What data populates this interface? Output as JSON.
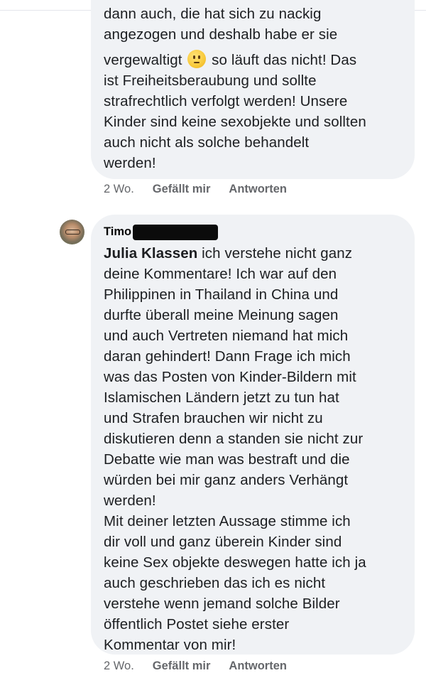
{
  "comment_1": {
    "lines": [
      "dann auch, die hat sich zu nackig",
      "angezogen und deshalb habe er sie",
      "vergewaltigt",
      " so läuft das nicht! Das",
      "ist Freiheitsberaubung und sollte",
      "strafrechtlich verfolgt werden! Unsere",
      "Kinder sind keine sexobjekte und sollten",
      "auch nicht als solche behandelt",
      "werden!"
    ],
    "emoji": "slightly-smiling-face-icon",
    "time": "2 Wo.",
    "like_label": "Gefällt mir",
    "reply_label": "Antworten"
  },
  "comment_2": {
    "author": "Timo",
    "mention": "Julia Klassen",
    "lines": [
      " ich verstehe nicht ganz",
      "deine Kommentare! Ich war auf den",
      "Philippinen in Thailand in China und",
      "durfte überall meine Meinung sagen",
      "und auch Vertreten niemand hat mich",
      "daran gehindert! Dann Frage ich mich",
      "was das Posten von Kinder-Bildern mit",
      "Islamischen Ländern jetzt zu tun hat",
      "und Strafen brauchen wir nicht zu",
      "diskutieren denn a standen sie nicht zur",
      "Debatte wie man was bestraft und die",
      "würden bei mir ganz anders Verhängt",
      "werden!",
      "Mit deiner letzten Aussage stimme ich",
      "dir voll und ganz überein Kinder sind",
      "keine Sex objekte deswegen hatte ich ja",
      "auch geschrieben das ich es nicht",
      "verstehe wenn jemand solche Bilder",
      "öffentlich Postet siehe erster",
      "Kommentar von mir!"
    ],
    "time": "2 Wo.",
    "like_label": "Gefällt mir",
    "reply_label": "Antworten"
  },
  "colors": {
    "bubble_bg": "#f0f2f5",
    "meta_text": "#65676b",
    "text": "#1c1e21"
  }
}
